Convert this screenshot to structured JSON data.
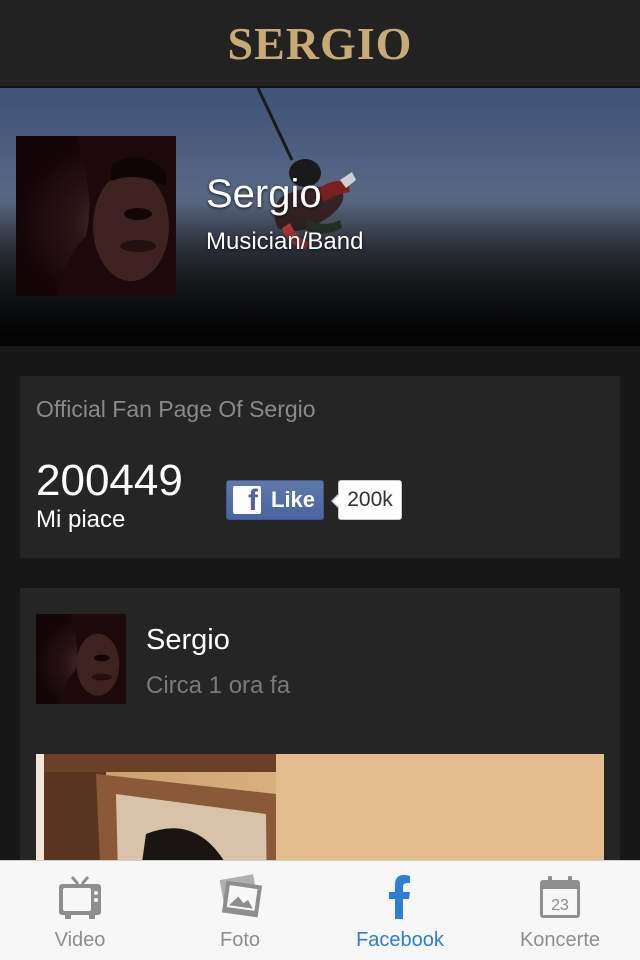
{
  "header": {
    "title": "SERGIO"
  },
  "profile": {
    "name": "Sergio",
    "category": "Musician/Band"
  },
  "like_card": {
    "title": "Official Fan Page Of Sergio",
    "likes_count": "200449",
    "likes_label": "Mi piace",
    "like_button_label": "Like",
    "like_bubble_count": "200k"
  },
  "post": {
    "author": "Sergio",
    "time": "Circa 1 ora fa"
  },
  "tabs": [
    {
      "label": "Video",
      "icon": "tv-icon",
      "active": false
    },
    {
      "label": "Foto",
      "icon": "photos-icon",
      "active": false
    },
    {
      "label": "Facebook",
      "icon": "facebook-icon",
      "active": true
    },
    {
      "label": "Koncerte",
      "icon": "calendar-icon",
      "active": false
    }
  ],
  "calendar_icon_day": "23",
  "colors": {
    "accent_gold": "#c8aa74",
    "active_tab": "#2c7ed6",
    "facebook_blue": "#4a64a0"
  }
}
